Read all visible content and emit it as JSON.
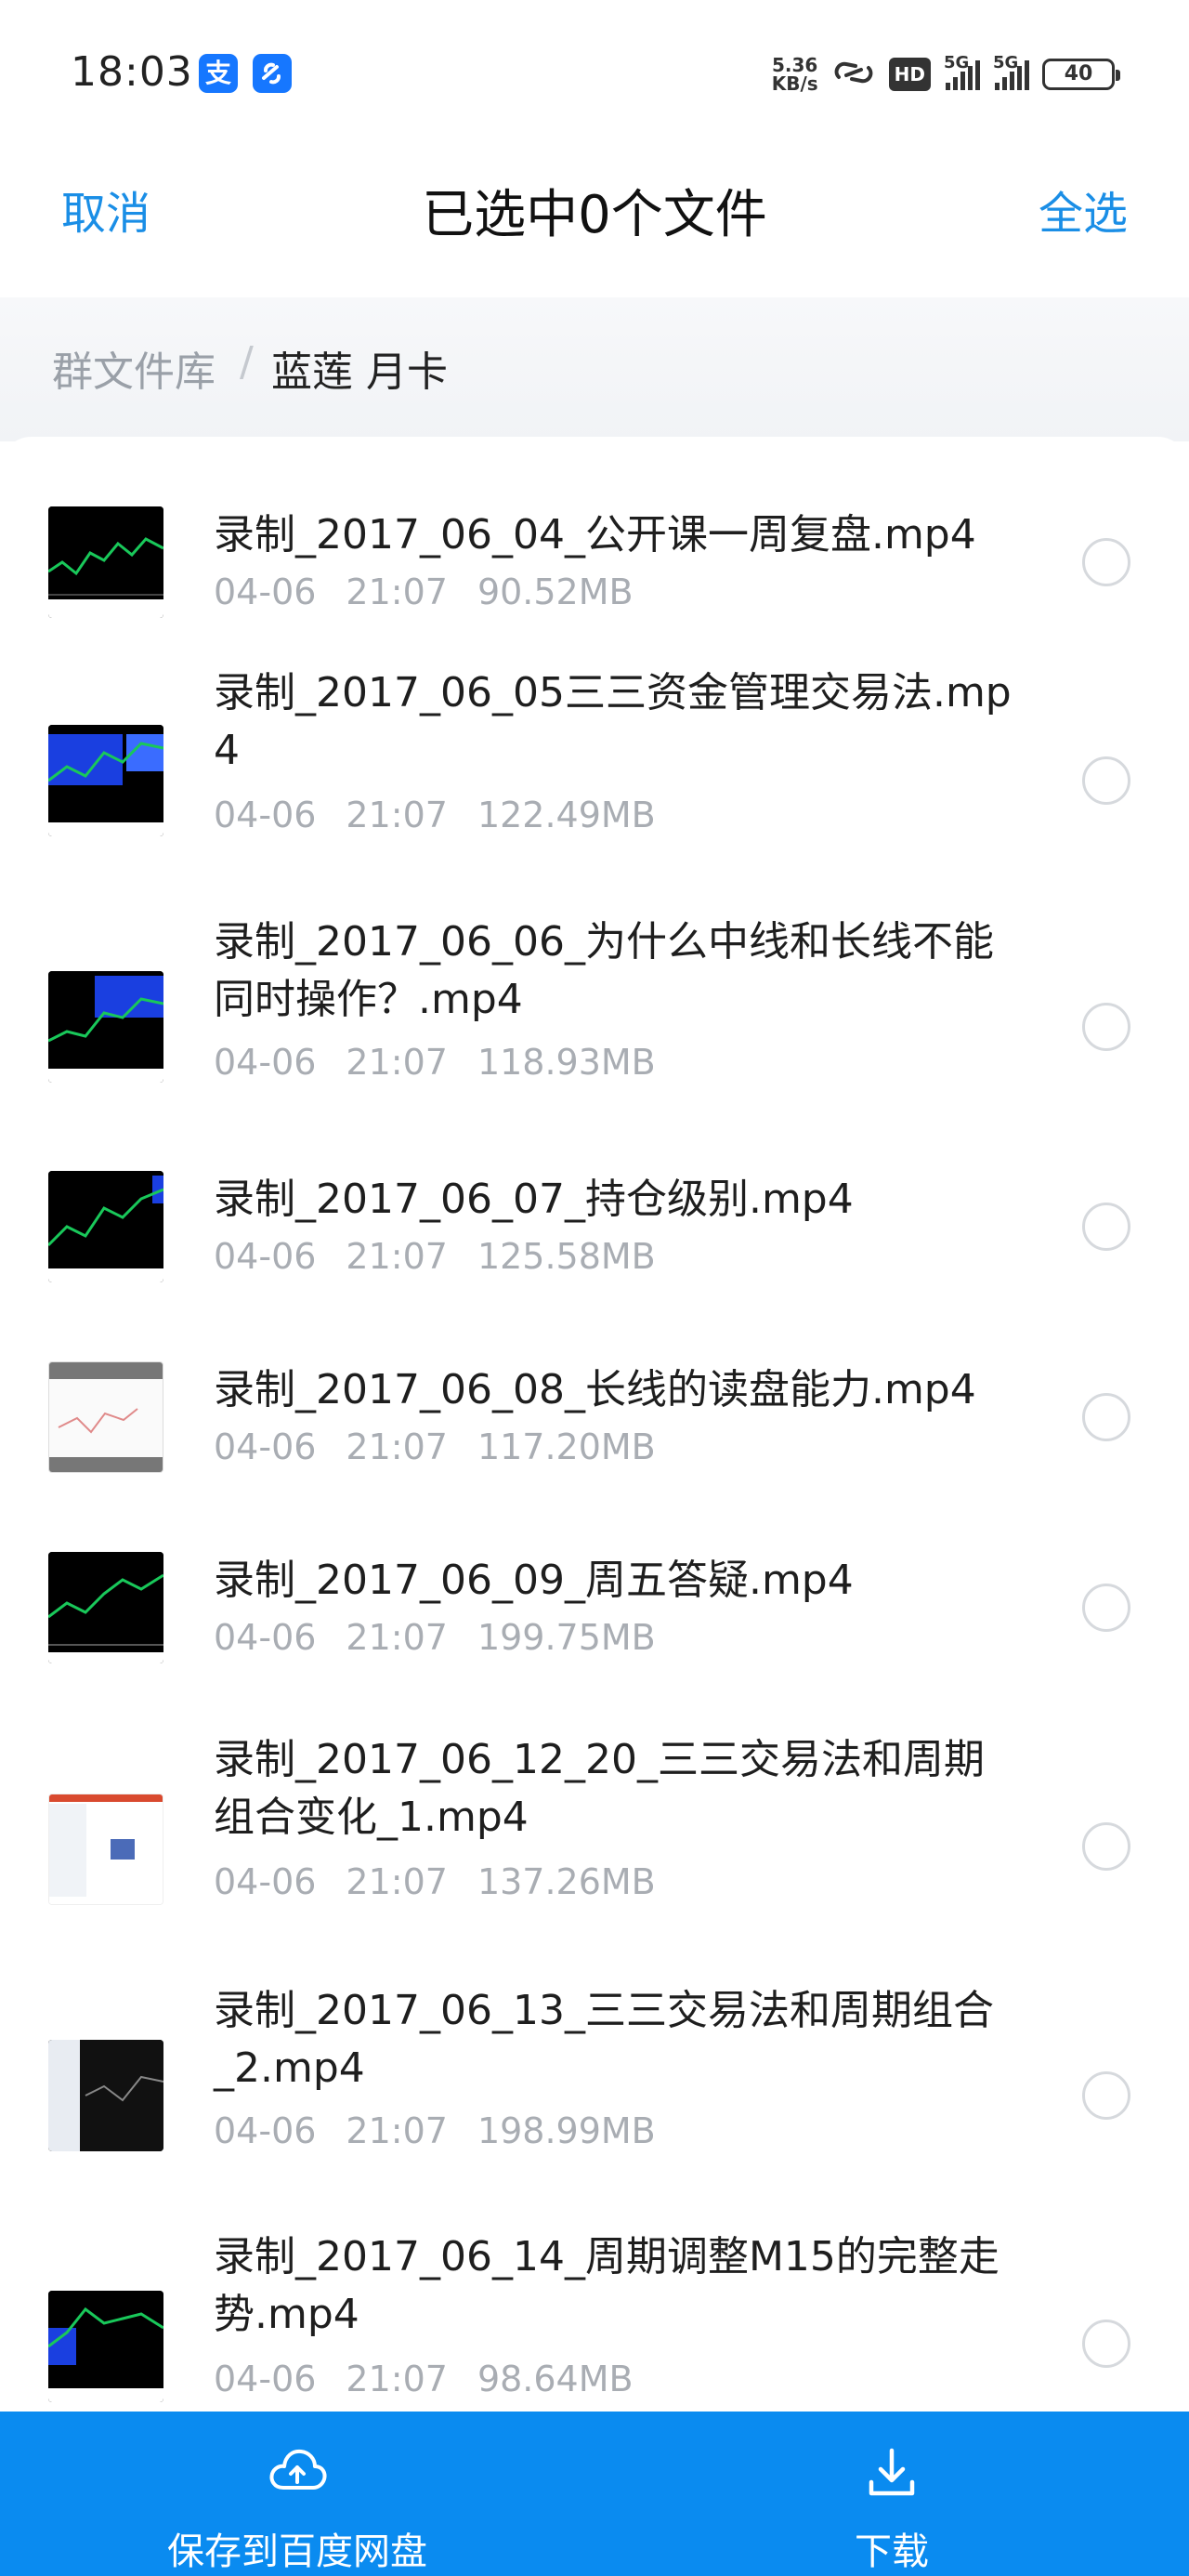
{
  "status_bar": {
    "time": "18:03",
    "app_icons": [
      "支",
      "alipay-link-icon"
    ],
    "net_speed_value": "5.36",
    "net_speed_unit": "KB/s",
    "hd_label": "HD",
    "signal_1_label": "5G",
    "signal_2_label": "5G",
    "battery": "40"
  },
  "header": {
    "cancel_label": "取消",
    "title": "已选中0个文件",
    "select_all_label": "全选"
  },
  "breadcrumb": {
    "root": "群文件库",
    "separator": "/",
    "current": "蓝莲 月卡"
  },
  "files": [
    {
      "name": "录制_2017_06_04_公开课一周复盘.mp4",
      "date": "04-06",
      "time": "21:07",
      "size": "90.52MB",
      "selected": false
    },
    {
      "name": "录制_2017_06_05三三资金管理交易法.mp4",
      "date": "04-06",
      "time": "21:07",
      "size": "122.49MB",
      "selected": false
    },
    {
      "name": "录制_2017_06_06_为什么中线和长线不能同时操作？.mp4",
      "date": "04-06",
      "time": "21:07",
      "size": "118.93MB",
      "selected": false
    },
    {
      "name": "录制_2017_06_07_持仓级别.mp4",
      "date": "04-06",
      "time": "21:07",
      "size": "125.58MB",
      "selected": false
    },
    {
      "name": "录制_2017_06_08_长线的读盘能力.mp4",
      "date": "04-06",
      "time": "21:07",
      "size": "117.20MB",
      "selected": false
    },
    {
      "name": "录制_2017_06_09_周五答疑.mp4",
      "date": "04-06",
      "time": "21:07",
      "size": "199.75MB",
      "selected": false
    },
    {
      "name": "录制_2017_06_12_20_三三交易法和周期组合变化_1.mp4",
      "date": "04-06",
      "time": "21:07",
      "size": "137.26MB",
      "selected": false
    },
    {
      "name": "录制_2017_06_13_三三交易法和周期组合_2.mp4",
      "date": "04-06",
      "time": "21:07",
      "size": "198.99MB",
      "selected": false
    },
    {
      "name": "录制_2017_06_14_周期调整M15的完整走势.mp4",
      "date": "04-06",
      "time": "21:07",
      "size": "98.64MB",
      "selected": false
    }
  ],
  "bottom_bar": {
    "save_label": "保存到百度网盘",
    "download_label": "下载",
    "save_icon": "cloud-upload-icon",
    "download_icon": "download-icon"
  },
  "colors": {
    "accent": "#1a8ee6",
    "bottom_bar": "#0a8bf0",
    "meta_text": "#a9adb3"
  }
}
